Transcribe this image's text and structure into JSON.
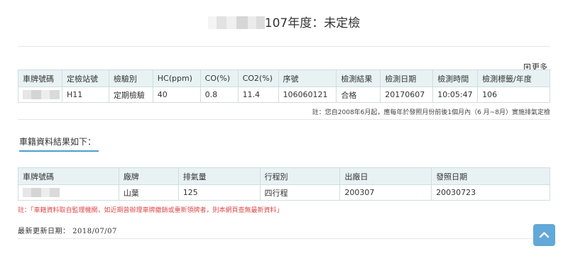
{
  "header": {
    "title_suffix": "107年度：未定檢"
  },
  "more_link": "更多",
  "inspection_table": {
    "headers": [
      "車牌號碼",
      "定檢站號",
      "檢驗別",
      "HC(ppm)",
      "CO(%)",
      "CO2(%)",
      "序號",
      "檢測結果",
      "檢測日期",
      "檢測時間",
      "檢測標籤/年度"
    ],
    "row": {
      "station": "H11",
      "type": "定期檢驗",
      "hc": "40",
      "co": "0.8",
      "co2": "11.4",
      "serial": "106060121",
      "result": "合格",
      "date": "20170607",
      "time": "10:05:47",
      "label_year": "106"
    },
    "note": "註：您自2008年6月起，應每年於發照月份前後1個月內（6 月~8月）實施排氣定檢"
  },
  "vehicle_section_title": "車籍資料結果如下：",
  "vehicle_table": {
    "headers": [
      "車牌號碼",
      "廠牌",
      "排氣量",
      "行程別",
      "出廠日",
      "發照日期"
    ],
    "row": {
      "brand": "山葉",
      "displacement": "125",
      "stroke": "四行程",
      "manufacture_date": "200307",
      "issue_date": "20030723"
    }
  },
  "vehicle_note": "註：「車籍資料取自監理機關，如近期曾辦理車牌繳銷或重新領牌者，則本網頁查無最新資料」",
  "last_updated": "最新更新日期： 2018/07/07"
}
